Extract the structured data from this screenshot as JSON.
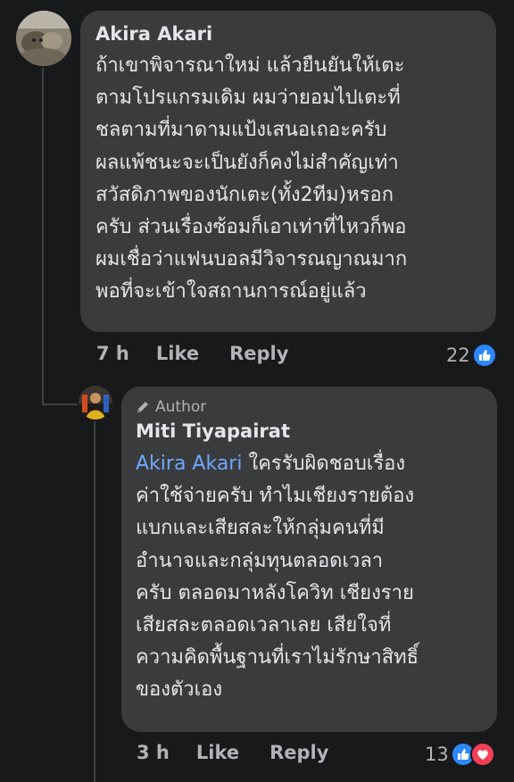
{
  "comment1": {
    "author": "Akira Akari",
    "text": "ถ้าเขาพิจารณาใหม่ แล้วยืนยันให้เตะ\nตามโปรแกรมเดิม ผมว่ายอมไปเตะที่\nชลตามที่มาดามแป้งเสนอเถอะครับ\nผลแพ้ชนะจะเป็นยังก็คงไม่สำคัญเท่า\nสวัสดิภาพของนักเตะ(ทั้ง2ทีม)หรอก\nครับ ส่วนเรื่องซ้อมก็เอาเท่าที่ไหวก็พอ\nผมเชื่อว่าแฟนบอลมีวิจารณญาณมาก\nพอที่จะเข้าใจสถานการณ์อยู่แล้ว",
    "time": "7 h",
    "like_label": "Like",
    "reply_label": "Reply",
    "reaction_count": "22"
  },
  "comment2": {
    "badge": "Author",
    "author": "Miti Tiyapairat",
    "mention": "Akira Akari",
    "text": " ใครรับผิดชอบเรื่อง\nค่าใช้จ่ายครับ ทำไมเชียงรายต้อง\nแบกและเสียสละให้กลุ่มคนที่มี\nอำนาจและกลุ่มทุนตลอดเวลา\nครับ ตลอดมาหลังโควิท เชียงราย\nเสียสละตลอดเวลาเลย เสียใจที่\nความคิดพื้นฐานที่เราไม่รักษาสิทธิ์\nของตัวเอง",
    "time": "3 h",
    "like_label": "Like",
    "reply_label": "Reply",
    "reaction_count": "13"
  },
  "colors": {
    "background": "#18191a",
    "bubble": "#3a3b3c",
    "mention": "#6fa8ff",
    "like_blue": "#2d88ff",
    "love_red": "#f33e58"
  }
}
